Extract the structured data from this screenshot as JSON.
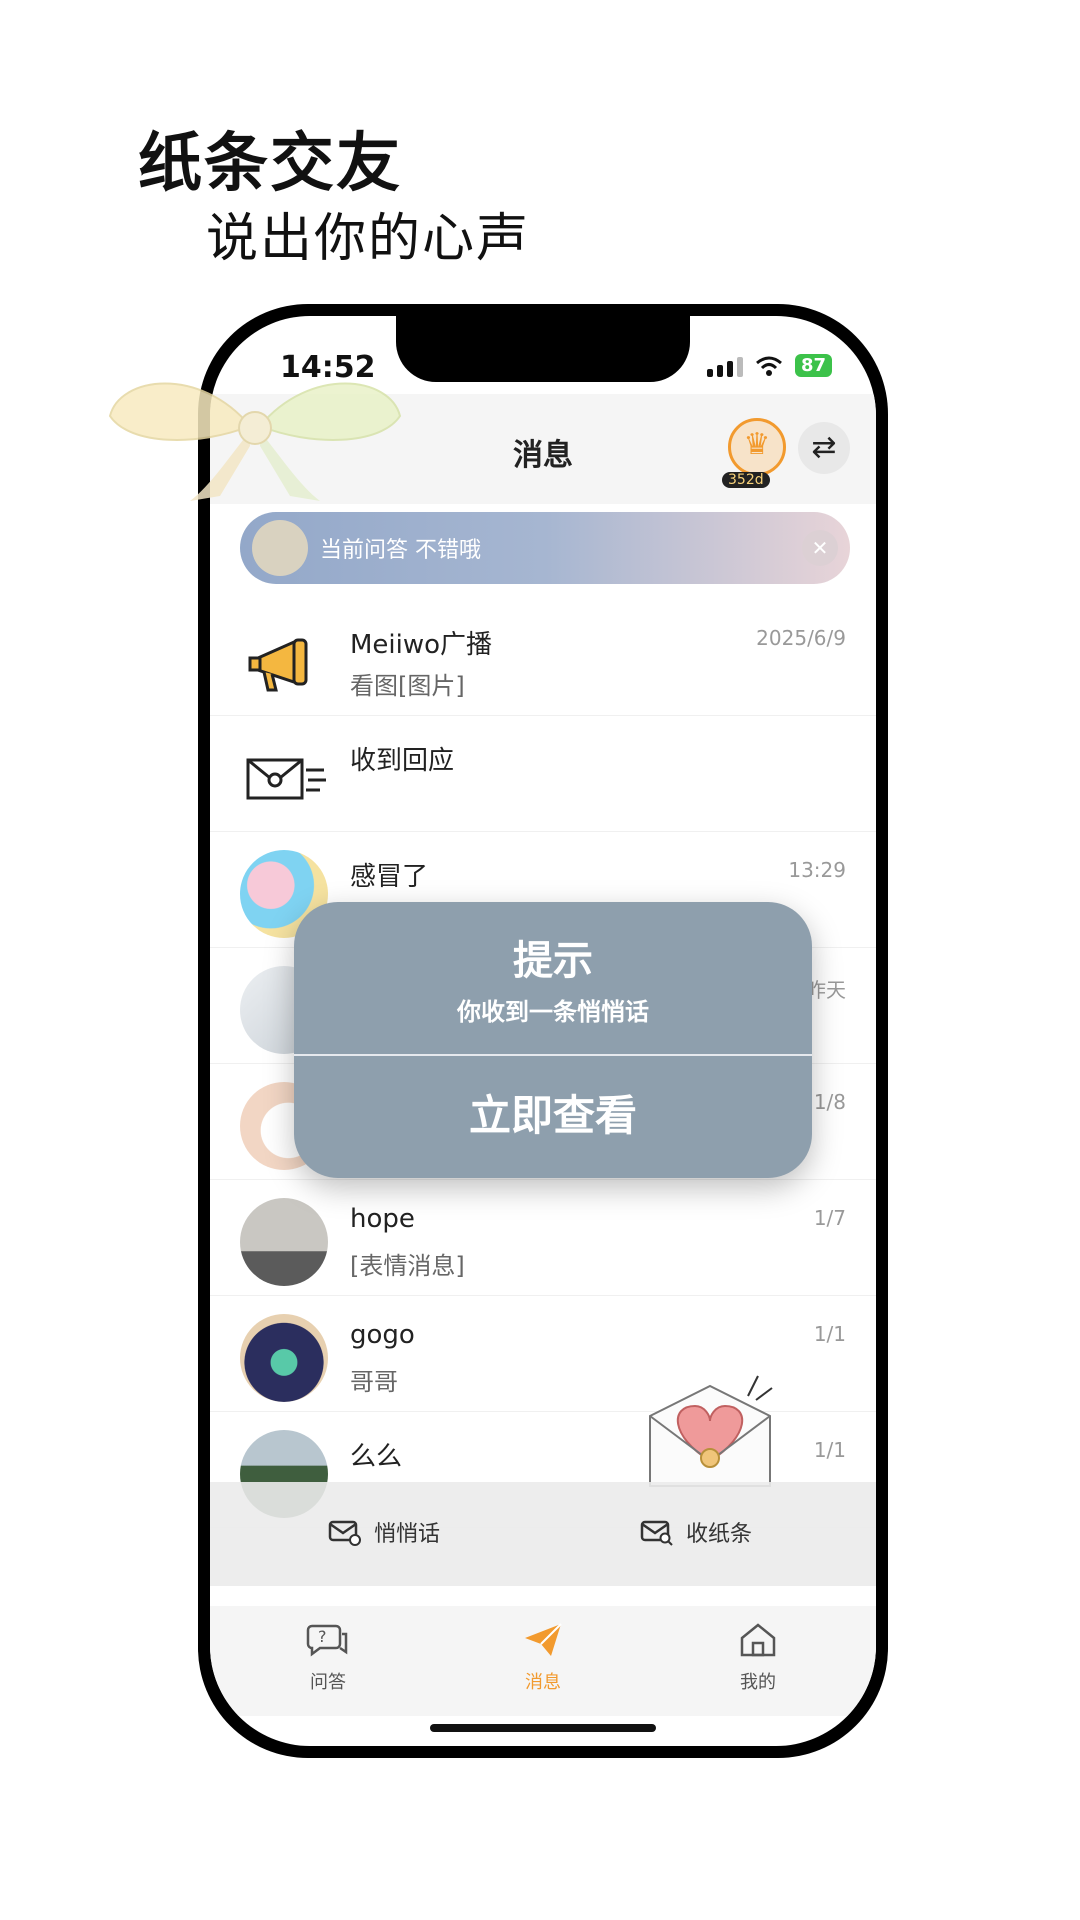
{
  "promo": {
    "title": "纸条交友",
    "subtitle": "说出你的心声"
  },
  "status_bar": {
    "time": "14:52",
    "battery": "87"
  },
  "header": {
    "title": "消息",
    "vip_days": "352d"
  },
  "announcement": {
    "text": "当前问答   不错哦"
  },
  "messages": [
    {
      "name": "Meiiwo广播",
      "preview": "看图[图片]",
      "time": "2025/6/9",
      "avatar": "megaphone-icon"
    },
    {
      "name": "收到回应",
      "preview": "",
      "time": "",
      "avatar": "envelope-icon"
    },
    {
      "name": "感冒了",
      "preview": "",
      "time": "13:29",
      "avatar": "cartoon"
    },
    {
      "name": "",
      "preview": "",
      "time": "昨天",
      "avatar": "photo"
    },
    {
      "name": "",
      "preview": "",
      "time": "1/8",
      "avatar": "cartoon"
    },
    {
      "name": "hope",
      "preview": "[表情消息]",
      "time": "1/7",
      "avatar": "photo"
    },
    {
      "name": "gogo",
      "preview": "哥哥",
      "time": "1/1",
      "avatar": "photo"
    },
    {
      "name": "么么",
      "preview": "",
      "time": "1/1",
      "avatar": "photo"
    }
  ],
  "dialog": {
    "title": "提示",
    "message": "你收到一条悄悄话",
    "button": "立即查看"
  },
  "actions": {
    "whisper": "悄悄话",
    "receive_note": "收纸条"
  },
  "tabs": {
    "qa": "问答",
    "messages": "消息",
    "mine": "我的"
  },
  "colors": {
    "accent": "#f29a2e",
    "dialog": "#8e9fad"
  }
}
